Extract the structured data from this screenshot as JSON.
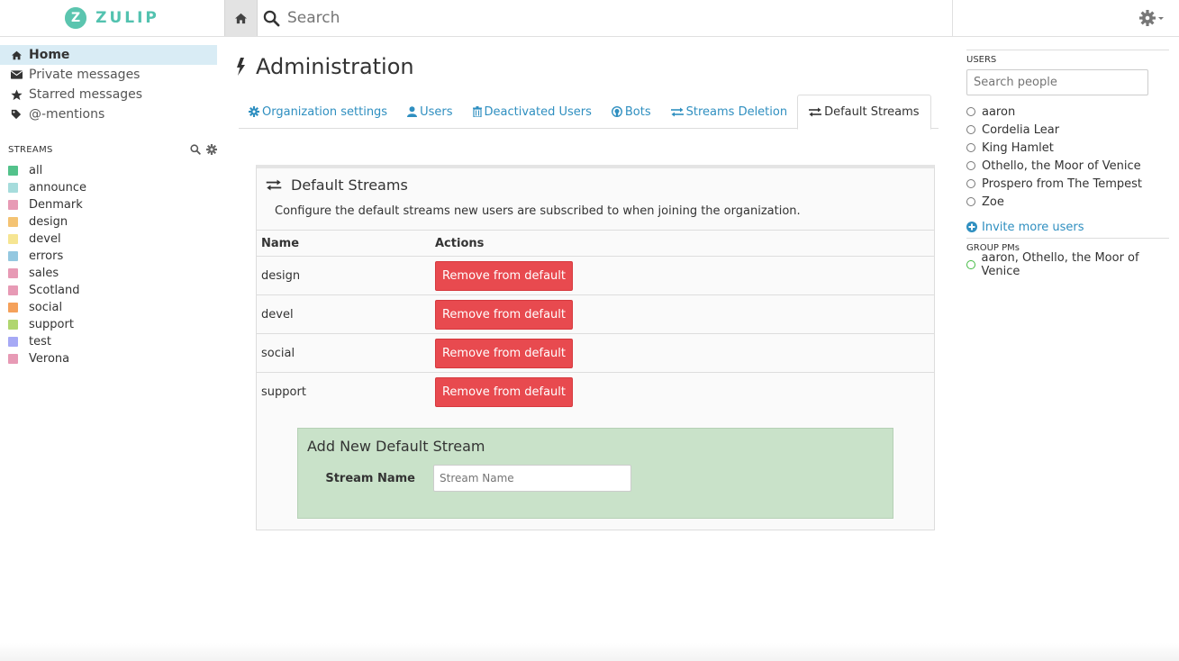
{
  "brand": {
    "name": "ZULIP",
    "logo_letter": "Z"
  },
  "search": {
    "placeholder": "Search"
  },
  "nav": [
    {
      "label": "Home",
      "icon": "home-icon"
    },
    {
      "label": "Private messages",
      "icon": "envelope-icon"
    },
    {
      "label": "Starred messages",
      "icon": "star-icon"
    },
    {
      "label": "@-mentions",
      "icon": "tag-icon"
    }
  ],
  "streams": {
    "header": "STREAMS",
    "items": [
      {
        "name": "all",
        "color": "#53c28b"
      },
      {
        "name": "announce",
        "color": "#a6dcdc"
      },
      {
        "name": "Denmark",
        "color": "#e79ab5"
      },
      {
        "name": "design",
        "color": "#f4c373"
      },
      {
        "name": "devel",
        "color": "#f6e592"
      },
      {
        "name": "errors",
        "color": "#94c8e0"
      },
      {
        "name": "sales",
        "color": "#e79ab5"
      },
      {
        "name": "Scotland",
        "color": "#e79ab5"
      },
      {
        "name": "social",
        "color": "#f5a15b"
      },
      {
        "name": "support",
        "color": "#b0d66f"
      },
      {
        "name": "test",
        "color": "#a6a9f5"
      },
      {
        "name": "Verona",
        "color": "#e79ab5"
      }
    ]
  },
  "admin": {
    "title": "Administration",
    "tabs": [
      {
        "label": "Organization settings",
        "icon": "gear-icon"
      },
      {
        "label": "Users",
        "icon": "user-icon"
      },
      {
        "label": "Deactivated Users",
        "icon": "trash-icon"
      },
      {
        "label": "Bots",
        "icon": "github-icon"
      },
      {
        "label": "Streams Deletion",
        "icon": "exchange-icon"
      },
      {
        "label": "Default Streams",
        "icon": "exchange-icon"
      }
    ],
    "panel": {
      "title": "Default Streams",
      "description": "Configure the default streams new users are subscribed to when joining the organization.",
      "columns": [
        "Name",
        "Actions"
      ],
      "rows": [
        {
          "name": "design",
          "action": "Remove from default"
        },
        {
          "name": "devel",
          "action": "Remove from default"
        },
        {
          "name": "social",
          "action": "Remove from default"
        },
        {
          "name": "support",
          "action": "Remove from default"
        }
      ],
      "add": {
        "title": "Add New Default Stream",
        "label": "Stream Name",
        "placeholder": "Stream Name"
      }
    }
  },
  "right": {
    "users_header": "USERS",
    "search_placeholder": "Search people",
    "users": [
      "aaron",
      "Cordelia Lear",
      "King Hamlet",
      "Othello, the Moor of Venice",
      "Prospero from The Tempest",
      "Zoe"
    ],
    "invite": "Invite more users",
    "group_header": "GROUP PMs",
    "group_pms": [
      "aaron, Othello, the Moor of Venice"
    ]
  },
  "colors": {
    "accent": "#52c2af",
    "link": "#2f8fc0",
    "danger": "#e84a4f",
    "add_bg": "#c9e2c9"
  }
}
